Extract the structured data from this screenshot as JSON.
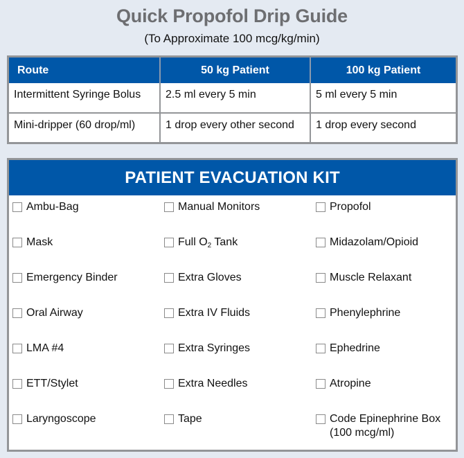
{
  "header": {
    "title": "Quick Propofol Drip Guide",
    "subtitle": "(To Approximate 100 mcg/kg/min)"
  },
  "drip_table": {
    "columns": [
      "Route",
      "50 kg Patient",
      "100 kg Patient"
    ],
    "rows": [
      [
        "Intermittent Syringe Bolus",
        "2.5 ml every 5 min",
        "5 ml every 5 min"
      ],
      [
        "Mini-dripper (60 drop/ml)",
        "1 drop every other second",
        "1 drop every second"
      ]
    ]
  },
  "kit": {
    "title": "PATIENT EVACUATION KIT",
    "columns": [
      {
        "items": [
          {
            "label": "Ambu-Bag",
            "checked": false
          },
          {
            "label": "Mask",
            "checked": false
          },
          {
            "label": "Emergency Binder",
            "checked": false
          },
          {
            "label": "Oral Airway",
            "checked": false
          },
          {
            "label": "LMA #4",
            "checked": false
          },
          {
            "label": "ETT/Stylet",
            "checked": false
          },
          {
            "label": "Laryngoscope",
            "checked": false
          }
        ]
      },
      {
        "items": [
          {
            "label": "Manual Monitors",
            "checked": false
          },
          {
            "label_pre": "Full O",
            "label_sub": "2",
            "label_post": " Tank",
            "checked": false
          },
          {
            "label": "Extra Gloves",
            "checked": false
          },
          {
            "label": "Extra IV Fluids",
            "checked": false
          },
          {
            "label": "Extra Syringes",
            "checked": false
          },
          {
            "label": "Extra Needles",
            "checked": false
          },
          {
            "label": "Tape",
            "checked": false
          }
        ]
      },
      {
        "items": [
          {
            "label": "Propofol",
            "checked": false
          },
          {
            "label": "Midazolam/Opioid",
            "checked": false
          },
          {
            "label": "Muscle Relaxant",
            "checked": false
          },
          {
            "label": "Phenylephrine",
            "checked": false
          },
          {
            "label": "Ephedrine",
            "checked": false
          },
          {
            "label": "Atropine",
            "checked": false
          },
          {
            "label": "Code Epinephrine Box",
            "note": "(100 mcg/ml)",
            "checked": false
          }
        ]
      }
    ]
  },
  "colors": {
    "background": "#e4eaf2",
    "title_gray": "#6d6e71",
    "header_blue": "#0057a8",
    "frame_gray": "#939598"
  }
}
